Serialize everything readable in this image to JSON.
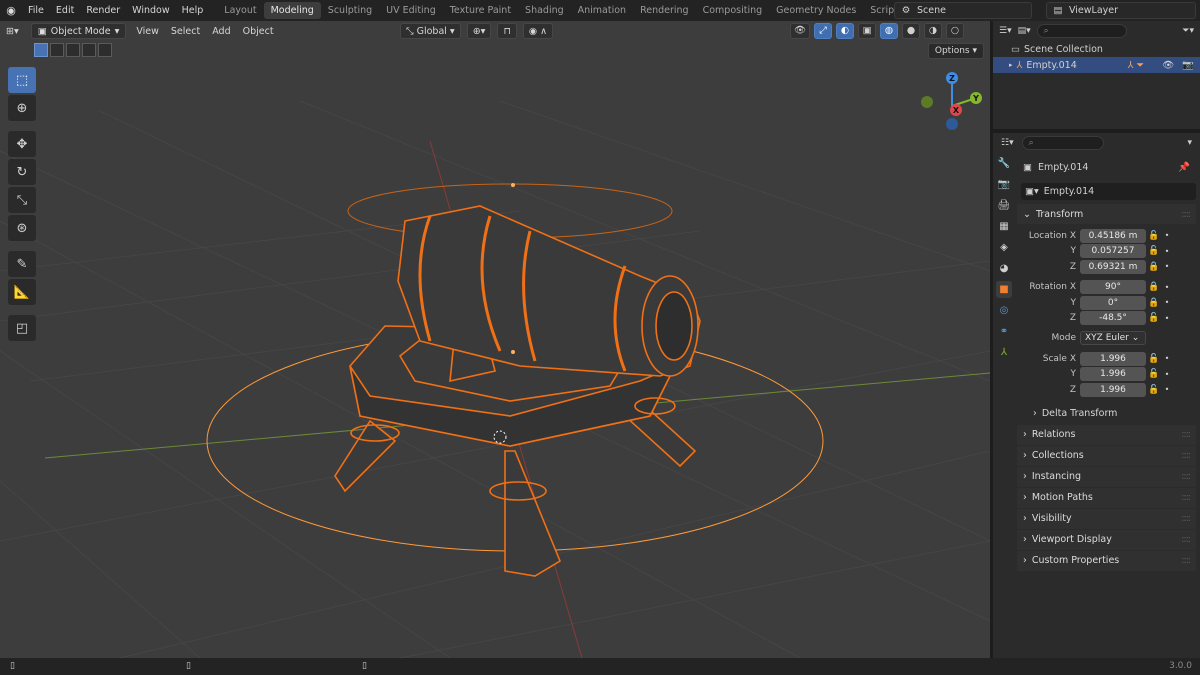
{
  "menu": [
    "File",
    "Edit",
    "Render",
    "Window",
    "Help"
  ],
  "workspaces": {
    "tabs": [
      "Layout",
      "Modeling",
      "Sculpting",
      "UV Editing",
      "Texture Paint",
      "Shading",
      "Animation",
      "Rendering",
      "Compositing",
      "Geometry Nodes",
      "Scripting"
    ],
    "active": "Modeling"
  },
  "scene": "Scene",
  "view_layer": "ViewLayer",
  "viewport": {
    "mode": "Object Mode",
    "menus": [
      "View",
      "Select",
      "Add",
      "Object"
    ],
    "orientation": "Global",
    "options_label": "Options",
    "gizmo": {
      "x": "X",
      "y": "Y",
      "z": "Z"
    }
  },
  "outliner": {
    "collection": "Scene Collection",
    "item": "Empty.014"
  },
  "properties": {
    "object_name": "Empty.014",
    "object_field": "Empty.014",
    "transform_label": "Transform",
    "location": {
      "label": "Location X",
      "x": "0.45186 m",
      "y": "0.057257",
      "z": "0.69321 m"
    },
    "rotation": {
      "label": "Rotation X",
      "x": "90°",
      "y": "0°",
      "z": "-48.5°"
    },
    "mode": {
      "label": "Mode",
      "value": "XYZ Euler"
    },
    "scale": {
      "label": "Scale X",
      "x": "1.996",
      "y": "1.996",
      "z": "1.996"
    },
    "axis_y": "Y",
    "axis_z": "Z",
    "delta_transform": "Delta Transform",
    "panels": [
      "Relations",
      "Collections",
      "Instancing",
      "Motion Paths",
      "Visibility",
      "Viewport Display",
      "Custom Properties"
    ]
  },
  "status": {
    "version": "3.0.0"
  },
  "colors": {
    "selection": "#f07016",
    "active": "#ff9a3a",
    "accent": "#4772b3",
    "axis_x": "#e0464c",
    "axis_y": "#84b72c",
    "axis_z": "#3f8de6"
  }
}
